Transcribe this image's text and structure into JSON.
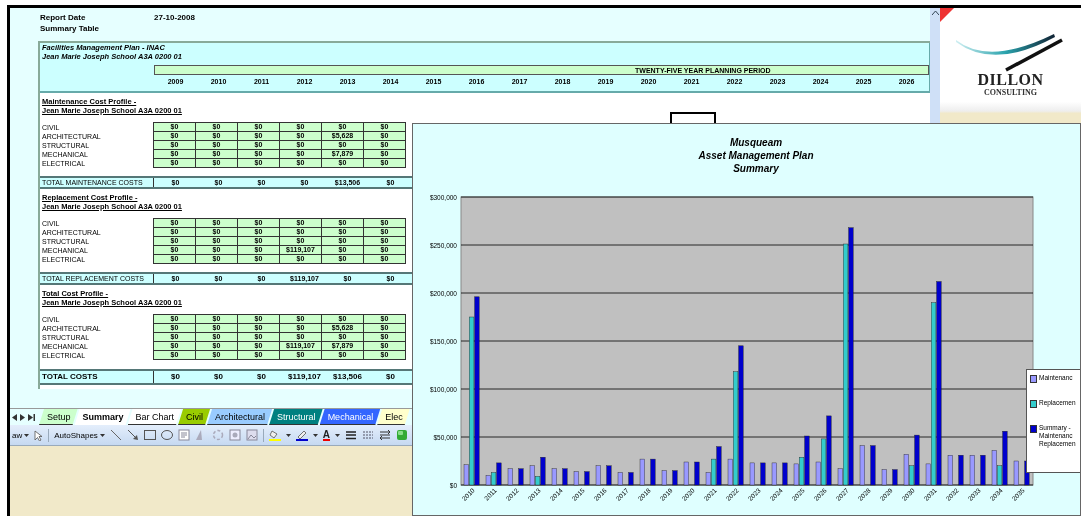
{
  "report": {
    "date_label": "Report Date",
    "date": "27-10-2008",
    "subtitle": "Summary Table"
  },
  "sheet": {
    "plan_title": "Facilities Management Plan  - INAC",
    "school": "Jean Marie Joseph School A3A 0200 01",
    "period_label": "TWENTY-FIVE YEAR PLANNING PERIOD",
    "years": [
      "2009",
      "2010",
      "2011",
      "2012",
      "2013",
      "2014",
      "2015",
      "2016",
      "2017",
      "2018",
      "2019",
      "2020",
      "2021",
      "2022",
      "2023",
      "2024",
      "2025",
      "2026"
    ],
    "sections": [
      {
        "title": "Maintenance Cost Profile -",
        "school": "Jean Marie Joseph School A3A 0200 01",
        "rows": [
          {
            "label": "CIVIL",
            "values": [
              "$0",
              "$0",
              "$0",
              "$0",
              "$0",
              "$0"
            ]
          },
          {
            "label": "ARCHITECTURAL",
            "values": [
              "$0",
              "$0",
              "$0",
              "$0",
              "$5,628",
              "$0"
            ]
          },
          {
            "label": "STRUCTURAL",
            "values": [
              "$0",
              "$0",
              "$0",
              "$0",
              "$0",
              "$0"
            ]
          },
          {
            "label": "MECHANICAL",
            "values": [
              "$0",
              "$0",
              "$0",
              "$0",
              "$7,879",
              "$0"
            ]
          },
          {
            "label": "ELECTRICAL",
            "values": [
              "$0",
              "$0",
              "$0",
              "$0",
              "$0",
              "$0"
            ]
          }
        ],
        "total": {
          "kind": "subtotal",
          "label": "TOTAL MAINTENANCE COSTS",
          "values": [
            "$0",
            "$0",
            "$0",
            "$0",
            "$13,506",
            "$0"
          ]
        }
      },
      {
        "title": "Replacement Cost Profile -",
        "school": "Jean Marie Joseph School A3A 0200 01",
        "rows": [
          {
            "label": "CIVIL",
            "values": [
              "$0",
              "$0",
              "$0",
              "$0",
              "$0",
              "$0"
            ]
          },
          {
            "label": "ARCHITECTURAL",
            "values": [
              "$0",
              "$0",
              "$0",
              "$0",
              "$0",
              "$0"
            ]
          },
          {
            "label": "STRUCTURAL",
            "values": [
              "$0",
              "$0",
              "$0",
              "$0",
              "$0",
              "$0"
            ]
          },
          {
            "label": "MECHANICAL",
            "values": [
              "$0",
              "$0",
              "$0",
              "$119,107",
              "$0",
              "$0"
            ]
          },
          {
            "label": "ELECTRICAL",
            "values": [
              "$0",
              "$0",
              "$0",
              "$0",
              "$0",
              "$0"
            ]
          }
        ],
        "total": {
          "kind": "subtotal",
          "label": "TOTAL REPLACEMENT COSTS",
          "values": [
            "$0",
            "$0",
            "$0",
            "$119,107",
            "$0",
            "$0"
          ]
        }
      },
      {
        "title": "Total Cost Profile -",
        "school": "Jean Marie Joseph School A3A 0200 01",
        "rows": [
          {
            "label": "CIVIL",
            "values": [
              "$0",
              "$0",
              "$0",
              "$0",
              "$0",
              "$0"
            ]
          },
          {
            "label": "ARCHITECTURAL",
            "values": [
              "$0",
              "$0",
              "$0",
              "$0",
              "$5,628",
              "$0"
            ]
          },
          {
            "label": "STRUCTURAL",
            "values": [
              "$0",
              "$0",
              "$0",
              "$0",
              "$0",
              "$0"
            ]
          },
          {
            "label": "MECHANICAL",
            "values": [
              "$0",
              "$0",
              "$0",
              "$119,107",
              "$7,879",
              "$0"
            ]
          },
          {
            "label": "ELECTRICAL",
            "values": [
              "$0",
              "$0",
              "$0",
              "$0",
              "$0",
              "$0"
            ]
          }
        ],
        "total": {
          "kind": "grand",
          "label": "TOTAL COSTS",
          "values": [
            "$0",
            "$0",
            "$0",
            "$119,107",
            "$13,506",
            "$0"
          ]
        }
      }
    ]
  },
  "sheet_tabs": [
    {
      "label": "Setup",
      "selected": false,
      "color": "#ccffcc"
    },
    {
      "label": "Summary",
      "selected": true,
      "color": "#ffffff"
    },
    {
      "label": "Bar Chart",
      "selected": false,
      "color": "#ffffff"
    },
    {
      "label": "Civil",
      "selected": false,
      "color": "#99cc00"
    },
    {
      "label": "Architectural",
      "selected": false,
      "color": "#99ccff"
    },
    {
      "label": "Structural",
      "selected": false,
      "color": "#008080"
    },
    {
      "label": "Mechanical",
      "selected": false,
      "color": "#3366ff"
    },
    {
      "label": "Elec",
      "selected": false,
      "color": "#ffffcc"
    }
  ],
  "toolbar": {
    "draw_menu": "aw",
    "autoshapes_menu": "AutoShapes",
    "font_color_glyph": "A"
  },
  "logo": {
    "name": "DILLON",
    "tagline": "CONSULTING"
  },
  "chart": {
    "chart_data": {
      "type": "bar",
      "grid": true,
      "title": "Musqueam\nAsset Management Plan\nSummary",
      "categories": [
        "2010",
        "2011",
        "2012",
        "2013",
        "2014",
        "2015",
        "2016",
        "2017",
        "2018",
        "2019",
        "2020",
        "2021",
        "2022",
        "2023",
        "2024",
        "2025",
        "2026",
        "2027",
        "2028",
        "2029",
        "2030",
        "2031",
        "2032",
        "2033",
        "2034",
        "2035"
      ],
      "series": [
        {
          "name": "Maintenanc",
          "color": "#9999ff",
          "values": [
            21000,
            10000,
            17000,
            20000,
            17000,
            14000,
            20000,
            13000,
            27000,
            15000,
            24000,
            13000,
            27000,
            23000,
            23000,
            22000,
            24000,
            17000,
            41000,
            16000,
            32000,
            22000,
            31000,
            31000,
            36000,
            25000
          ]
        },
        {
          "name": "Replacemen",
          "color": "#33cccc",
          "values": [
            175000,
            13000,
            null,
            9000,
            null,
            null,
            null,
            null,
            null,
            null,
            null,
            27000,
            118000,
            null,
            null,
            29000,
            48000,
            251000,
            null,
            null,
            20000,
            190000,
            null,
            null,
            20000,
            null
          ]
        },
        {
          "name": "Summary - Maintenanc Replacemen",
          "color": "#0000cc",
          "values": [
            196000,
            23000,
            17000,
            29000,
            17000,
            14000,
            20000,
            13000,
            27000,
            15000,
            24000,
            40000,
            145000,
            23000,
            23000,
            51000,
            72000,
            268000,
            41000,
            16000,
            52000,
            212000,
            31000,
            31000,
            56000,
            25000
          ]
        }
      ],
      "ylim": [
        0,
        300000
      ],
      "yticks": [
        {
          "value": 0,
          "label": "$0"
        },
        {
          "value": 50000,
          "label": "$50,000"
        },
        {
          "value": 100000,
          "label": "$100,000"
        },
        {
          "value": 150000,
          "label": "$150,000"
        },
        {
          "value": 200000,
          "label": "$200,000"
        },
        {
          "value": 250000,
          "label": "$250,000"
        },
        {
          "value": 300000,
          "label": "$300,000"
        }
      ]
    }
  }
}
